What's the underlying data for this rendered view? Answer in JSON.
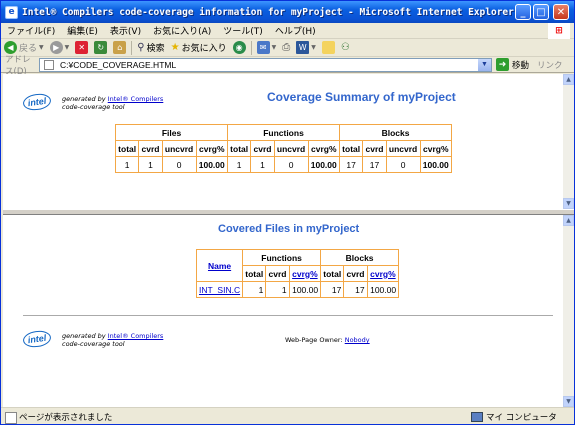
{
  "window": {
    "title": "Intel® Compilers code-coverage information for myProject - Microsoft Internet Explorer",
    "min_glyph": "_",
    "max_glyph": "□",
    "close_glyph": "✕"
  },
  "menu": [
    "ファイル(F)",
    "編集(E)",
    "表示(V)",
    "お気に入り(A)",
    "ツール(T)",
    "ヘルプ(H)"
  ],
  "toolbar": {
    "back": "戻る",
    "search": "検索",
    "favorites": "お気に入り"
  },
  "address": {
    "label": "アドレス(D)",
    "value": "C:¥CODE_COVERAGE.HTML",
    "go": "移動",
    "links": "リンク"
  },
  "top": {
    "logo": "intel",
    "generated_by": "generated by",
    "compilers_link": "Intel® Compilers",
    "tool": "code-coverage tool",
    "title": "Coverage Summary of myProject",
    "groups": [
      "Files",
      "Functions",
      "Blocks"
    ],
    "subheaders": [
      "total",
      "cvrd",
      "uncvrd",
      "cvrg%",
      "total",
      "cvrd",
      "uncvrd",
      "cvrg%",
      "total",
      "cvrd",
      "uncvrd",
      "cvrg%"
    ],
    "row": [
      "1",
      "1",
      "0",
      "100.00",
      "1",
      "1",
      "0",
      "100.00",
      "17",
      "17",
      "0",
      "100.00"
    ]
  },
  "bottom": {
    "title": "Covered Files in myProject",
    "name_header": "Name",
    "groups": [
      "Functions",
      "Blocks"
    ],
    "subheaders": [
      "total",
      "cvrd",
      "cvrg%",
      "total",
      "cvrd",
      "cvrg%"
    ],
    "rows": [
      {
        "name": "INT_SIN.C",
        "cells": [
          "1",
          "1",
          "100.00",
          "17",
          "17",
          "100.00"
        ]
      }
    ],
    "logo": "intel",
    "generated_by": "generated by",
    "compilers_link": "Intel® Compilers",
    "tool": "code-coverage tool",
    "owner_label": "Web-Page Owner:",
    "owner": "Nobody"
  },
  "status": {
    "text": "ページが表示されました",
    "zone": "マイ コンピュータ"
  }
}
